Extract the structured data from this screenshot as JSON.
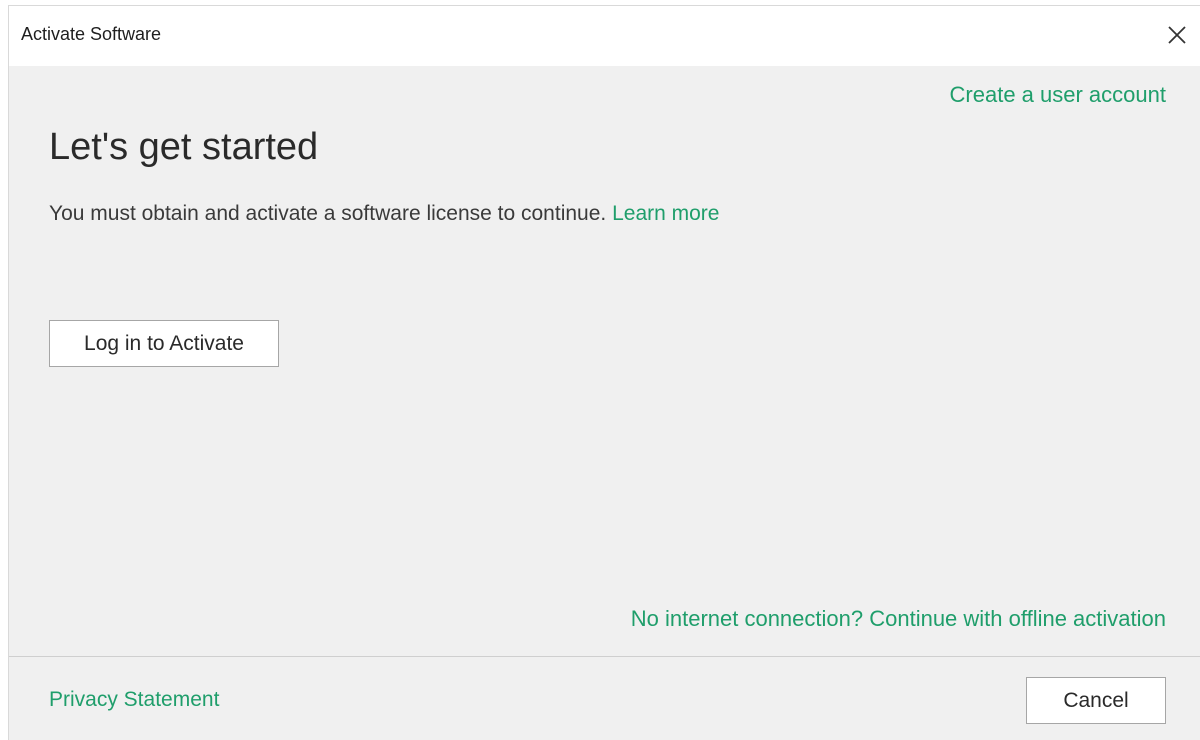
{
  "window": {
    "title": "Activate Software",
    "close_icon": "close-icon"
  },
  "main": {
    "create_account_link": "Create a user account",
    "heading": "Let's get started",
    "info_text": "You must obtain and activate a software license to continue.",
    "learn_more_link": "Learn more",
    "login_button": "Log in to Activate",
    "offline_link": "No internet connection? Continue with offline activation"
  },
  "footer": {
    "privacy_link": "Privacy Statement",
    "cancel_button": "Cancel"
  },
  "colors": {
    "accent": "#1f9e6b",
    "background": "#f0f0f0",
    "titlebar": "#ffffff"
  }
}
